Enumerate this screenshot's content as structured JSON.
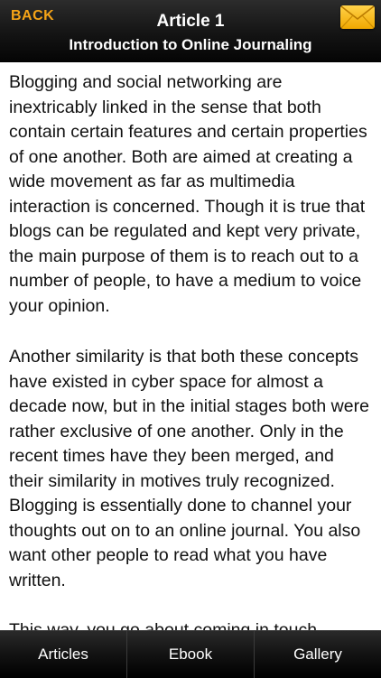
{
  "header": {
    "back_label": "BACK",
    "title": "Article 1",
    "subtitle": "Introduction to Online Journaling",
    "mail_icon": "envelope-icon"
  },
  "article": {
    "paragraphs": [
      "Blogging and social networking are inextricably linked in the sense that both contain certain features and certain properties of one another. Both are aimed at creating a wide movement as far as multimedia interaction is concerned. Though it is true that blogs can be regulated and kept very private, the main purpose of them is to reach out to a number of people, to have a medium to voice your opinion.",
      "Another similarity is that both these concepts have existed in cyber space for almost a decade now, but in the initial stages both were rather exclusive of one another. Only in the recent times have they been merged, and their similarity in motives truly recognized. Blogging is essentially done to channel your thoughts out on to an online journal. You also want other people to read what you have written.",
      "This way, you go about coming in touch"
    ]
  },
  "tabbar": {
    "tabs": [
      {
        "label": "Articles"
      },
      {
        "label": "Ebook"
      },
      {
        "label": "Gallery"
      }
    ]
  },
  "colors": {
    "accent": "#f5a317",
    "bar_dark": "#0a0a0a"
  }
}
